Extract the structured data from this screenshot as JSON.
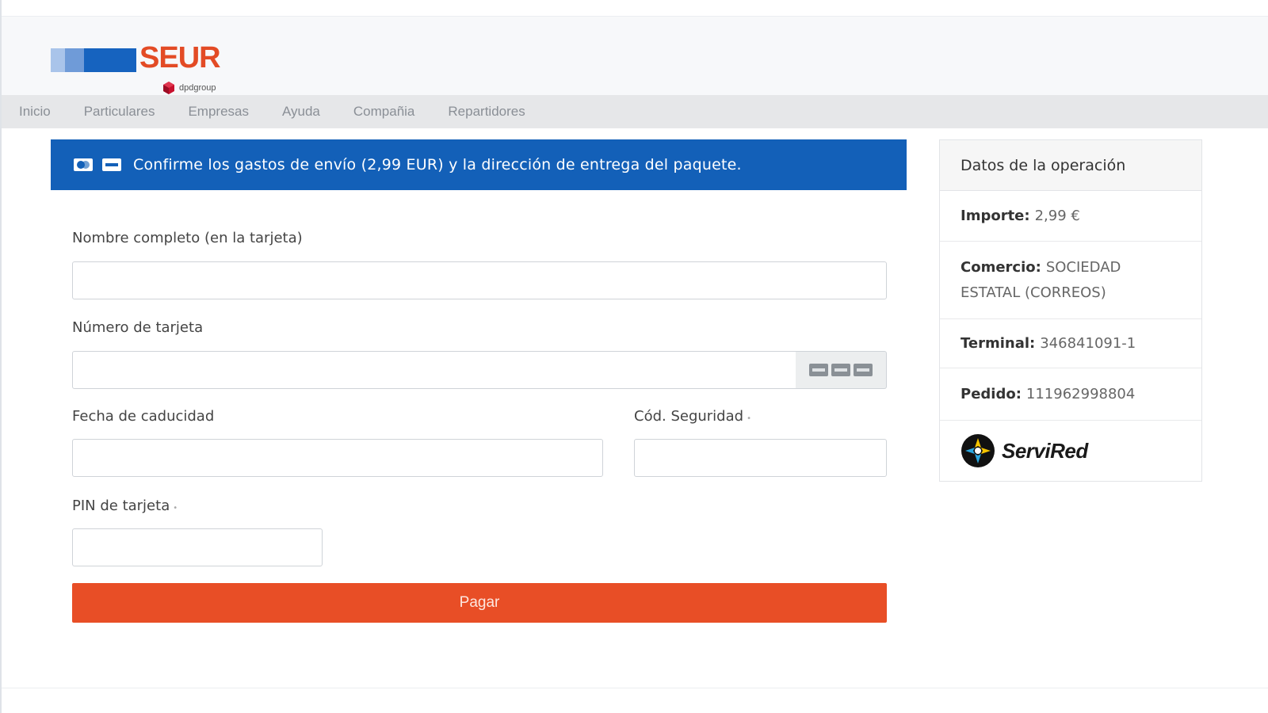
{
  "brand": {
    "name": "SEUR",
    "sub": "dpdgroup",
    "colors": {
      "accent": "#e34b25",
      "blue": "#1663bf"
    }
  },
  "nav": {
    "items": [
      "Inicio",
      "Particulares",
      "Empresas",
      "Ayuda",
      "Compañia",
      "Repartidores"
    ]
  },
  "alert": {
    "text": "Confirme los gastos de envío (2,99 EUR) y la dirección de entrega del paquete.",
    "icons": [
      "card-icon",
      "card-brand-icon"
    ]
  },
  "form": {
    "name_label": "Nombre completo (en la tarjeta)",
    "name_value": "",
    "card_label": "Número de tarjeta",
    "card_value": "",
    "expiry_label": "Fecha de caducidad",
    "expiry_value": "",
    "cvv_label": "Cód. Seguridad",
    "cvv_value": "",
    "pin_label": "PIN de tarjeta",
    "pin_value": "",
    "required_mark": "•",
    "pay_label": "Pagar",
    "pay_color": "#e84e26"
  },
  "panel": {
    "title": "Datos de la operación",
    "importe_label": "Importe:",
    "importe_value": "2,99 €",
    "comercio_label": "Comercio:",
    "comercio_value": "SOCIEDAD ESTATAL (CORREOS)",
    "terminal_label": "Terminal:",
    "terminal_value": "346841091-1",
    "pedido_label": "Pedido:",
    "pedido_value": "111962998804",
    "brand": "ServiRed"
  }
}
